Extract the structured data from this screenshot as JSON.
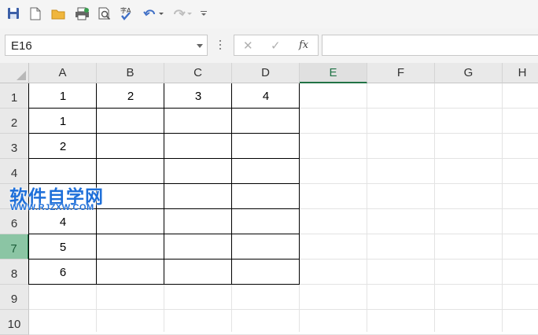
{
  "toolbar": {
    "icons": [
      "save-icon",
      "new-document-icon",
      "open-folder-icon",
      "print-icon",
      "print-preview-icon",
      "spell-check-icon",
      "undo-icon",
      "redo-icon",
      "customize-toolbar-icon"
    ]
  },
  "formula_bar": {
    "name_box": "E16",
    "cancel_glyph": "✕",
    "enter_glyph": "✓",
    "fx_label": "fx",
    "formula": ""
  },
  "columns": [
    "A",
    "B",
    "C",
    "D",
    "E",
    "F",
    "G",
    "H"
  ],
  "selected_column": "E",
  "rows": [
    "1",
    "2",
    "3",
    "4",
    "5",
    "6",
    "7",
    "8",
    "9",
    "10"
  ],
  "selected_row": "7",
  "cells": {
    "A1": "1",
    "B1": "2",
    "C1": "3",
    "D1": "4",
    "A2": "1",
    "A3": "2",
    "A6": "4",
    "A7": "5",
    "A8": "6"
  },
  "watermark": {
    "title": "软件自学网",
    "url": "WWW.RJZXW.COM"
  },
  "colors": {
    "accent": "#217346",
    "selected_row_fill": "#8bc5a4",
    "watermark": "#1e6fd9"
  }
}
